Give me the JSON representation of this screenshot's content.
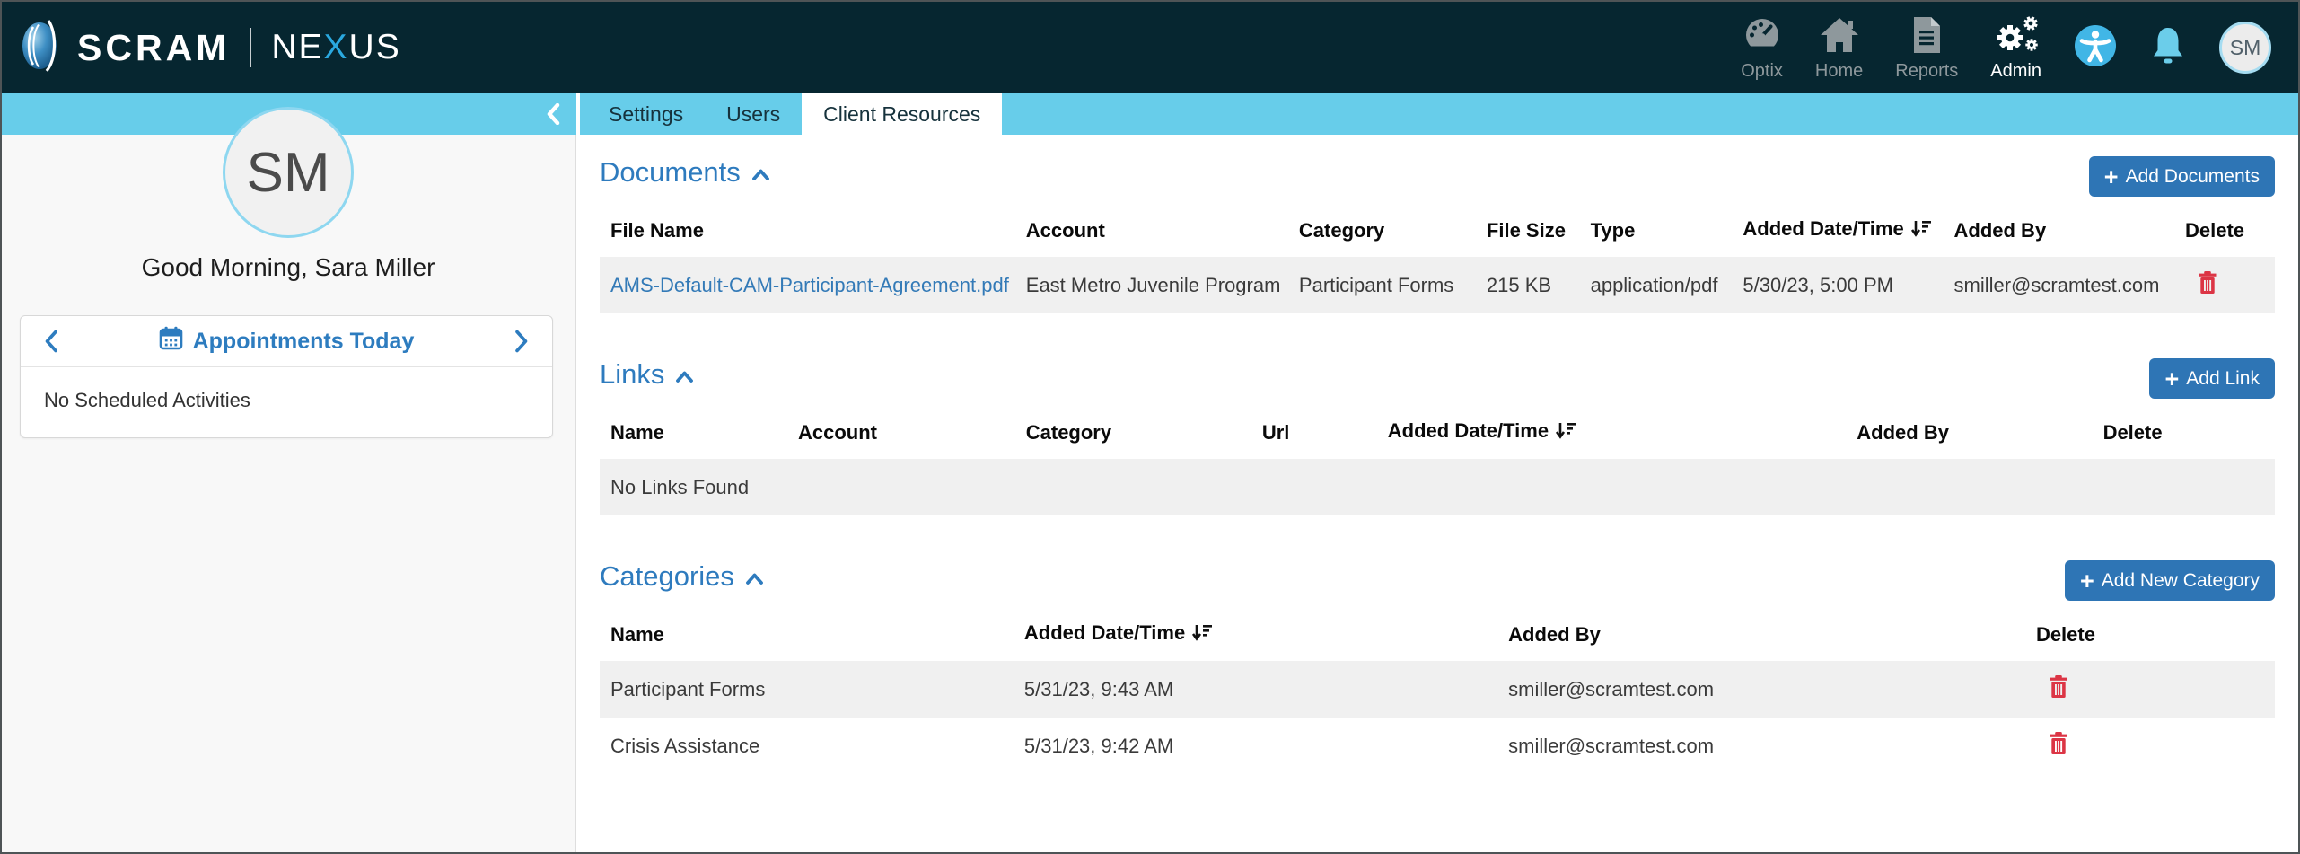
{
  "brand": {
    "primary": "SCRAM",
    "divider": "|",
    "secondary_pre": "NE",
    "secondary_x": "X",
    "secondary_post": "US"
  },
  "topnav": {
    "items": [
      {
        "label": "Optix",
        "icon": "gauge-icon",
        "active": false
      },
      {
        "label": "Home",
        "icon": "home-icon",
        "active": false
      },
      {
        "label": "Reports",
        "icon": "report-icon",
        "active": false
      },
      {
        "label": "Admin",
        "icon": "gears-icon",
        "active": true
      }
    ],
    "avatar_initials": "SM"
  },
  "tabs": {
    "items": [
      "Settings",
      "Users",
      "Client Resources"
    ],
    "active": "Client Resources"
  },
  "sidebar": {
    "avatar_initials": "SM",
    "greeting": "Good Morning, Sara Miller",
    "appointments": {
      "title": "Appointments Today",
      "empty_message": "No Scheduled Activities"
    }
  },
  "documents": {
    "title": "Documents",
    "add_button": "Add Documents",
    "columns": [
      "File Name",
      "Account",
      "Category",
      "File Size",
      "Type",
      "Added Date/Time",
      "Added By",
      "Delete"
    ],
    "sort_column": "Added Date/Time",
    "rows": [
      {
        "file_name": "AMS-Default-CAM-Participant-Agreement.pdf",
        "account": "East Metro Juvenile Program",
        "category": "Participant Forms",
        "file_size": "215 KB",
        "type": "application/pdf",
        "added": "5/30/23, 5:00 PM",
        "added_by": "smiller@scramtest.com"
      }
    ]
  },
  "links": {
    "title": "Links",
    "add_button": "Add Link",
    "columns": [
      "Name",
      "Account",
      "Category",
      "Url",
      "Added Date/Time",
      "Added By",
      "Delete"
    ],
    "sort_column": "Added Date/Time",
    "empty_message": "No Links Found"
  },
  "categories": {
    "title": "Categories",
    "add_button": "Add New Category",
    "columns": [
      "Name",
      "Added Date/Time",
      "Added By",
      "Delete"
    ],
    "sort_column": "Added Date/Time",
    "rows": [
      {
        "name": "Participant Forms",
        "added": "5/31/23, 9:43 AM",
        "added_by": "smiller@scramtest.com"
      },
      {
        "name": "Crisis Assistance",
        "added": "5/31/23, 9:42 AM",
        "added_by": "smiller@scramtest.com"
      }
    ]
  },
  "colors": {
    "topbar_bg": "#062630",
    "accent_bar": "#67cdea",
    "primary_button": "#2e75b5",
    "section_title": "#2e7bbe",
    "link": "#337ab7",
    "delete_icon": "#dc3545",
    "nexus_x": "#2aa9e0"
  }
}
